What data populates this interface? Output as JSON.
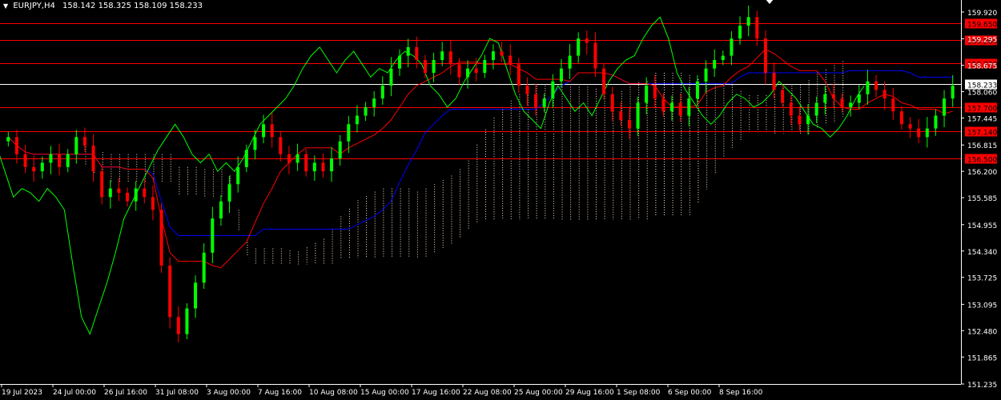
{
  "window": {
    "symbol": "EURJPY,H4",
    "ohlc": "158.142 158.325 158.109 158.233",
    "dropdown_icon": "triangle-down-icon",
    "corner_icon": "triangle-down-icon"
  },
  "colors": {
    "background": "#000000",
    "axis": "#ffffff",
    "bull_candle": "#00ff00",
    "bear_candle": "#ff0000",
    "level_line": "#ff0000",
    "current_price_line": "#ffffff",
    "tenkan": "#ff0000",
    "kijun": "#0000ff",
    "chikou": "#00ff00",
    "cloud": "#ffe4c4"
  },
  "chart_data": {
    "type": "candlestick",
    "ylim": [
      151.235,
      160.2
    ],
    "y_ticks": [
      "159.920",
      "159.295",
      "158.675",
      "158.060",
      "157.445",
      "156.815",
      "156.200",
      "155.585",
      "154.955",
      "154.340",
      "153.725",
      "153.095",
      "152.480",
      "151.865",
      "151.235"
    ],
    "x_ticks": [
      "19 Jul 2023",
      "24 Jul 00:00",
      "26 Jul 16:00",
      "31 Jul 08:00",
      "3 Aug 00:00",
      "7 Aug 16:00",
      "10 Aug 08:00",
      "15 Aug 00:00",
      "17 Aug 16:00",
      "22 Aug 08:00",
      "25 Aug 00:00",
      "29 Aug 16:00",
      "1 Sep 08:00",
      "6 Sep 00:00",
      "8 Sep 16:00"
    ],
    "current_price": {
      "value": 158.233,
      "label": "158.233"
    },
    "levels": [
      {
        "value": 159.65,
        "label": "159.650"
      },
      {
        "value": 159.26,
        "label": "159.260"
      },
      {
        "value": 158.73,
        "label": "158.730"
      },
      {
        "value": 157.7,
        "label": "157.700"
      },
      {
        "value": 157.14,
        "label": "157.140"
      },
      {
        "value": 156.5,
        "label": "156.500"
      }
    ],
    "close_series": [
      157.0,
      156.6,
      156.3,
      156.2,
      156.4,
      156.6,
      156.3,
      156.6,
      157.0,
      156.8,
      156.2,
      155.6,
      155.8,
      155.7,
      155.5,
      155.8,
      155.6,
      155.3,
      154.0,
      152.8,
      152.4,
      153.0,
      153.6,
      154.3,
      155.1,
      155.5,
      155.9,
      156.3,
      156.7,
      157.0,
      157.3,
      157.0,
      156.6,
      156.4,
      156.6,
      156.2,
      156.4,
      156.2,
      156.5,
      156.9,
      157.3,
      157.5,
      157.7,
      157.9,
      158.2,
      158.6,
      158.9,
      159.1,
      158.8,
      158.5,
      158.8,
      159.0,
      158.7,
      158.4,
      158.6,
      158.5,
      158.8,
      159.0,
      158.9,
      158.7,
      158.2,
      158.0,
      157.7,
      157.9,
      158.3,
      158.6,
      158.9,
      159.3,
      159.2,
      158.6,
      158.0,
      157.6,
      157.4,
      157.2,
      157.8,
      158.2,
      157.9,
      157.6,
      157.8,
      157.5,
      157.9,
      158.3,
      158.6,
      158.8,
      158.9,
      159.3,
      159.6,
      159.8,
      159.3,
      158.5,
      158.1,
      157.8,
      157.5,
      157.3,
      157.5,
      157.8,
      158.0,
      157.9,
      157.7,
      157.8,
      158.0,
      158.3,
      158.1,
      157.9,
      157.6,
      157.3,
      157.2,
      157.0,
      157.2,
      157.5,
      157.9,
      158.2
    ]
  }
}
